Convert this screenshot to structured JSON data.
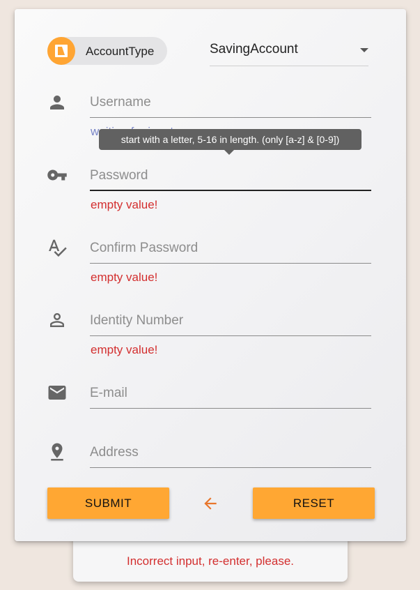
{
  "account_type": {
    "chip_label": "AccountType",
    "selected": "SavingAccount"
  },
  "fields": {
    "username": {
      "placeholder": "Username",
      "hint": "waiting for input"
    },
    "password": {
      "placeholder": "Password",
      "hint": "empty value!"
    },
    "confirm_password": {
      "placeholder": "Confirm Password",
      "hint": "empty value!"
    },
    "identity_number": {
      "placeholder": "Identity Number",
      "hint": "empty value!"
    },
    "email": {
      "placeholder": "E-mail"
    },
    "address": {
      "placeholder": "Address"
    }
  },
  "tooltip": {
    "text": "start with a letter, 5-16 in length. (only [a-z] & [0-9])"
  },
  "actions": {
    "submit_label": "SUBMIT",
    "reset_label": "RESET"
  },
  "toast": {
    "message": "Incorrect input, re-enter, please."
  },
  "colors": {
    "accent": "#ffa733",
    "error": "#d32f2f",
    "icon": "#666666",
    "back_arrow": "#e8762c"
  },
  "icons": [
    "account-type-icon",
    "person-icon",
    "key-icon",
    "spellcheck-icon",
    "person-outline-icon",
    "email-icon",
    "place-icon",
    "arrow-back-icon",
    "dropdown-caret-icon"
  ]
}
